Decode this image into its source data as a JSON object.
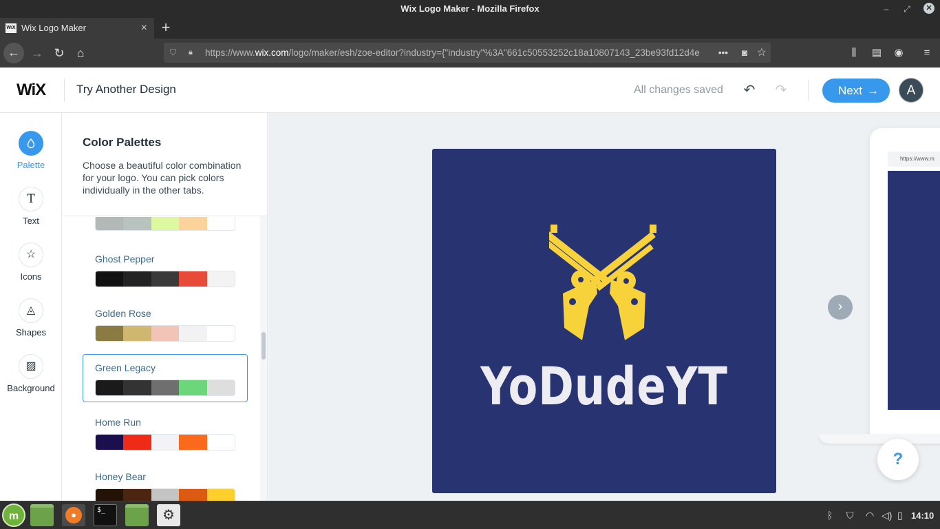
{
  "window": {
    "title": "Wix Logo Maker - Mozilla Firefox"
  },
  "browser": {
    "tab_title": "Wix Logo Maker",
    "tab_favicon": "WiX",
    "url_prefix": "https://www.",
    "url_domain": "wix.com",
    "url_rest": "/logo/maker/esh/zoe-editor?industry={\"industry\"%3A\"661c50553252c18a10807143_23be93fd12d4e"
  },
  "header": {
    "logo": "WiX",
    "try_another": "Try Another Design",
    "saved_status": "All changes saved",
    "next_label": "Next",
    "avatar_initial": "A"
  },
  "rail": {
    "items": [
      {
        "label": "Palette",
        "icon": "drop-icon"
      },
      {
        "label": "Text",
        "icon": "text-icon"
      },
      {
        "label": "Icons",
        "icon": "star-icon"
      },
      {
        "label": "Shapes",
        "icon": "shapes-icon"
      },
      {
        "label": "Background",
        "icon": "background-icon"
      }
    ]
  },
  "panel": {
    "title": "Color Palettes",
    "description": "Choose a beautiful color combination for your logo. You can pick colors individually in the other tabs.",
    "palettes": [
      {
        "name": "",
        "colors": [
          "#b3b9b7",
          "#b8c3bf",
          "#dcf99f",
          "#fdd39c",
          "#ffffff"
        ]
      },
      {
        "name": "Ghost Pepper",
        "colors": [
          "#111111",
          "#232323",
          "#3a3a3a",
          "#e84a3a",
          "#f3f3f3"
        ]
      },
      {
        "name": "Golden Rose",
        "colors": [
          "#8c7a43",
          "#cfb76f",
          "#f2c4b8",
          "#f2f2f2",
          "#ffffff"
        ]
      },
      {
        "name": "Green Legacy",
        "colors": [
          "#1a1a1a",
          "#333333",
          "#6f6f6f",
          "#6cd77a",
          "#dedede"
        ]
      },
      {
        "name": "Home Run",
        "colors": [
          "#1c0f4d",
          "#ef2a16",
          "#f3f3f7",
          "#fb6a1b",
          "#ffffff"
        ]
      },
      {
        "name": "Honey Bear",
        "colors": [
          "#241207",
          "#4b2510",
          "#c4c4c4",
          "#dd5a12",
          "#ffcf2d"
        ]
      }
    ]
  },
  "canvas": {
    "logo_text": "YoDudeYT",
    "logo_bg": "#283371",
    "logo_icon_color": "#f7d23a",
    "logo_text_color": "#ececf2",
    "mockup_url": "https://www.m",
    "help_label": "?"
  },
  "taskbar": {
    "clock": "14:10"
  }
}
